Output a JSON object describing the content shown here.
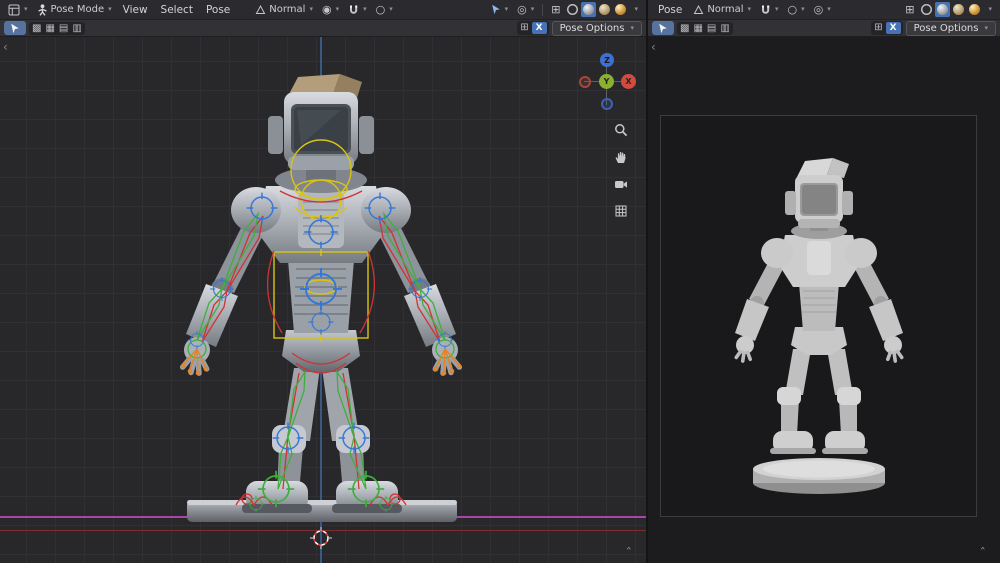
{
  "colors": {
    "accent_blue": "#4772b3",
    "header_bg": "#2b2b2f",
    "viewport_bg": "#28282b",
    "rig_yellow": "#d9c412",
    "rig_red": "#cf3434",
    "rig_green": "#3fae3f",
    "rig_blue": "#3577d6",
    "rig_orange": "#e8821e",
    "axis_x": "#d24b3e",
    "axis_y": "#8ab12e",
    "axis_z": "#3f6fd0",
    "floor_line_magenta": "#a846a8",
    "floor_line_red": "#7c2d2d"
  },
  "icons": {
    "dropdown": "▾",
    "xray": "⊞",
    "pivot": "◉",
    "proportional": "○",
    "overlays": "◎",
    "pattern_icons": [
      "▩",
      "▦",
      "▤",
      "▥"
    ],
    "x_mirror": "X",
    "collapse_chevron": "‹",
    "expand_chevron": "ˆ"
  },
  "left_viewport": {
    "mode": "Pose Mode",
    "menus": [
      "View",
      "Select",
      "Pose"
    ],
    "orientation": "Normal",
    "pose_options": "Pose Options",
    "gizmo": {
      "x": "X",
      "y": "Y",
      "z": "Z"
    }
  },
  "right_viewport": {
    "menus": [
      "Pose"
    ],
    "orientation": "Normal",
    "pose_options": "Pose Options"
  }
}
